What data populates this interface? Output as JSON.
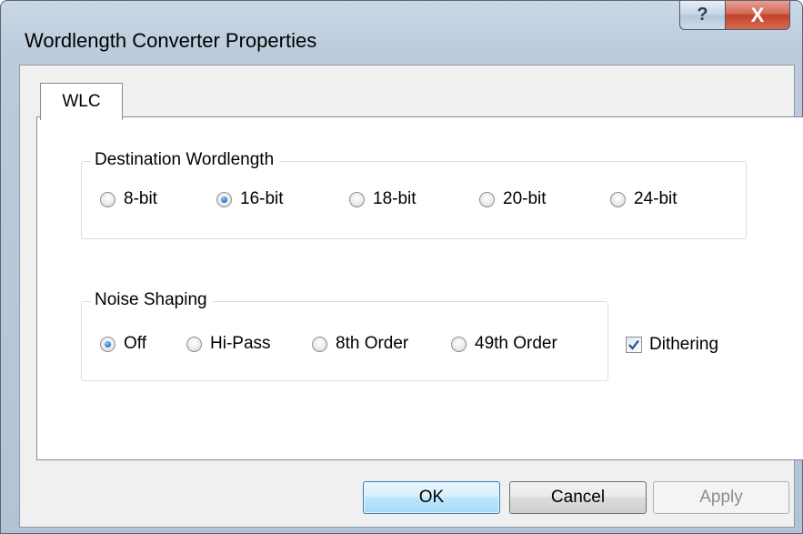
{
  "window": {
    "title": "Wordlength Converter Properties",
    "help_label": "?",
    "close_label": "X"
  },
  "tabs": [
    {
      "label": "WLC",
      "selected": true
    }
  ],
  "destination_wordlength": {
    "label": "Destination Wordlength",
    "options": [
      {
        "label": "8-bit",
        "checked": false
      },
      {
        "label": "16-bit",
        "checked": true
      },
      {
        "label": "18-bit",
        "checked": false
      },
      {
        "label": "20-bit",
        "checked": false
      },
      {
        "label": "24-bit",
        "checked": false
      }
    ]
  },
  "noise_shaping": {
    "label": "Noise Shaping",
    "options": [
      {
        "label": "Off",
        "checked": true
      },
      {
        "label": "Hi-Pass",
        "checked": false
      },
      {
        "label": "8th Order",
        "checked": false
      },
      {
        "label": "49th Order",
        "checked": false
      }
    ]
  },
  "dithering": {
    "label": "Dithering",
    "checked": true
  },
  "buttons": {
    "ok": "OK",
    "cancel": "Cancel",
    "apply": "Apply",
    "apply_enabled": false
  },
  "colors": {
    "accent_blue": "#3c7fb1",
    "close_red": "#c1422b",
    "frame_blue": "#bccbdc"
  }
}
